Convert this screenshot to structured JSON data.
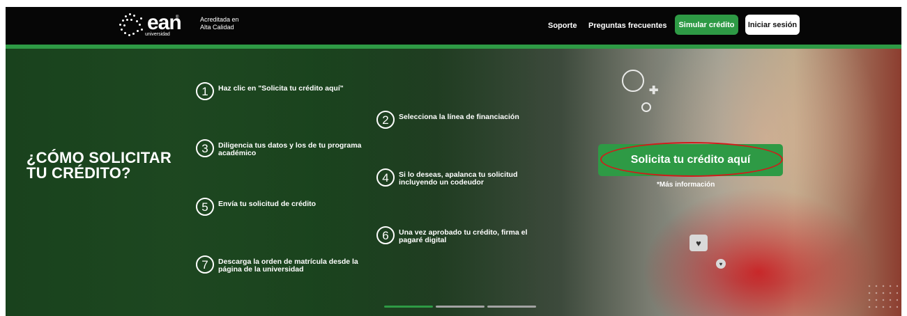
{
  "header": {
    "logo_word": "ean",
    "logo_sub": "universidad",
    "logo_reg": "®",
    "accreditation_line1": "Acreditada en",
    "accreditation_line2": "Alta Calidad",
    "nav": {
      "support": "Soporte",
      "faq": "Preguntas frecuentes",
      "simulate": "Simular crédito",
      "login": "Iniciar sesión"
    }
  },
  "hero": {
    "title_line1": "¿CÓMO SOLICITAR",
    "title_line2": "TU CRÉDITO?",
    "steps": [
      {
        "num": "1",
        "text": "Haz clic en \"Solicita tu crédito aquí\""
      },
      {
        "num": "2",
        "text": "Selecciona la línea de financiación"
      },
      {
        "num": "3",
        "text": "Diligencia tus datos y los de tu programa académico"
      },
      {
        "num": "4",
        "text": "Si lo deseas, apalanca tu solicitud incluyendo un codeudor"
      },
      {
        "num": "5",
        "text": "Envía tu solicitud de crédito"
      },
      {
        "num": "6",
        "text": "Una vez aprobado tu crédito, firma el pagaré digital"
      },
      {
        "num": "7",
        "text": "Descarga la orden de matrícula desde la página de la universidad"
      }
    ],
    "cta_label": "Solicita tu crédito aquí",
    "more_info": "*Más información",
    "carousel": {
      "slides": 3,
      "active": 1
    }
  },
  "colors": {
    "accent_green": "#2e9a45",
    "annotation_red": "#d21a1a",
    "topbar": "#060606"
  }
}
